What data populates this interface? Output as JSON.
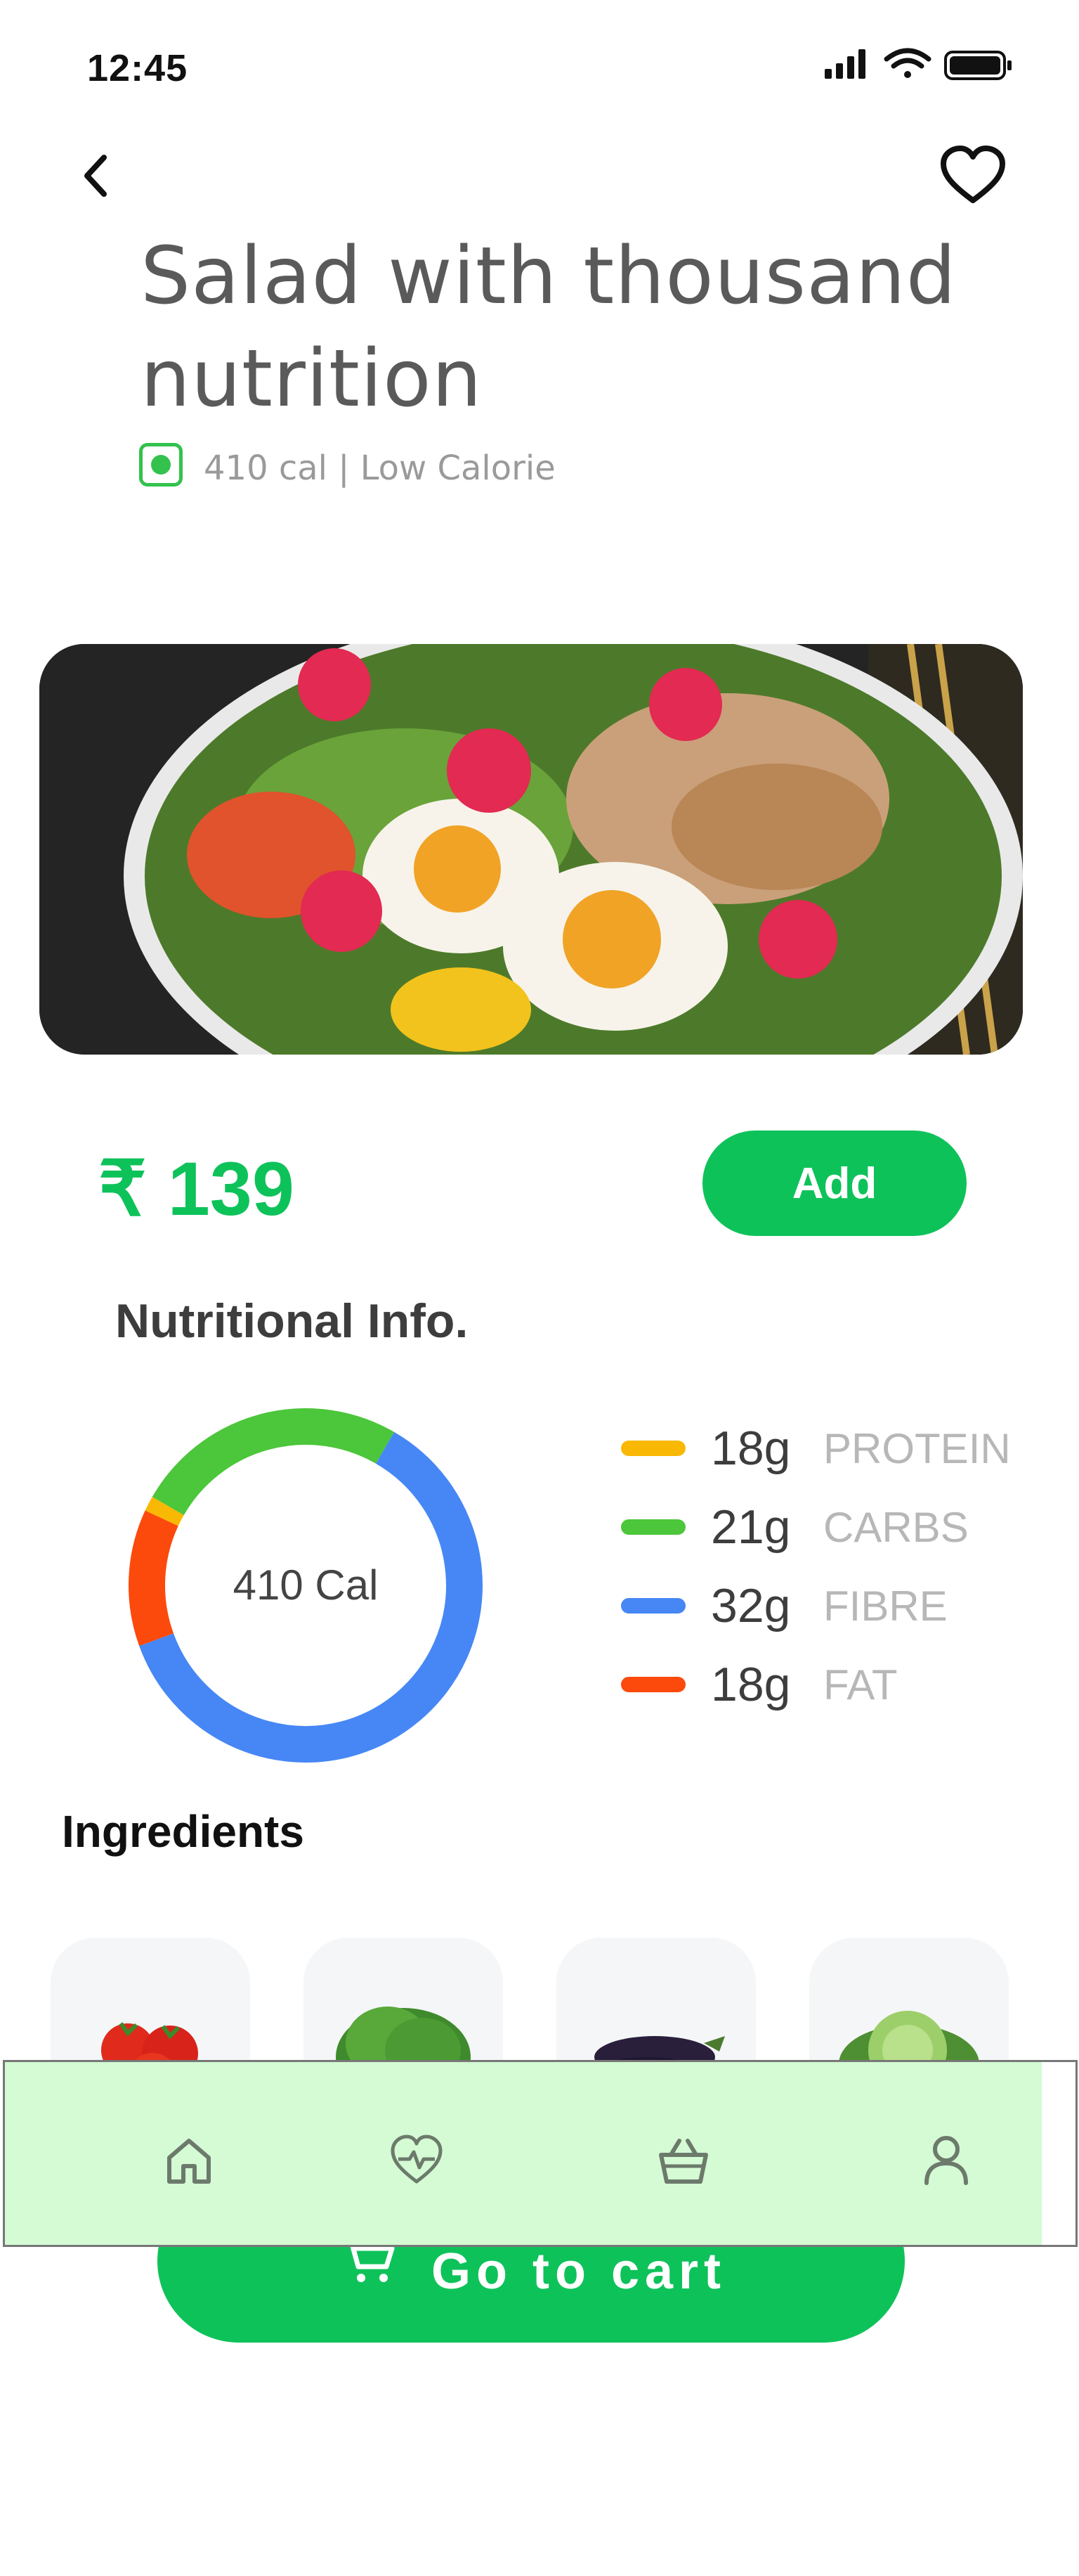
{
  "status_bar": {
    "time": "12:45"
  },
  "header": {
    "back_icon": "chevron-left-icon",
    "favorite_icon": "heart-icon",
    "title": "Salad with thousand nutrition",
    "meta": "410 cal | Low Calorie"
  },
  "product": {
    "price": "₹ 139",
    "add_label": "Add"
  },
  "nutrition": {
    "title": "Nutritional Info.",
    "total": "410 Cal",
    "items": [
      {
        "amount": "18g",
        "label": "PROTEIN",
        "color": "#f9b804"
      },
      {
        "amount": "21g",
        "label": "CARBS",
        "color": "#4cc63a"
      },
      {
        "amount": "32g",
        "label": "FIBRE",
        "color": "#4687f5"
      },
      {
        "amount": "18g",
        "label": "FAT",
        "color": "#fc4a0d"
      }
    ]
  },
  "ingredients": {
    "title": "Ingredients",
    "items": [
      "tomato-icon",
      "lettuce-icon",
      "eggplant-icon",
      "cabbage-icon"
    ]
  },
  "cart": {
    "label": "Go to cart",
    "icon": "cart-icon"
  },
  "bottom_nav": {
    "items": [
      "home-icon",
      "heart-pulse-icon",
      "basket-icon",
      "profile-icon"
    ]
  },
  "colors": {
    "accent": "#0ec25a",
    "nav_background": "#d4fbd3"
  }
}
